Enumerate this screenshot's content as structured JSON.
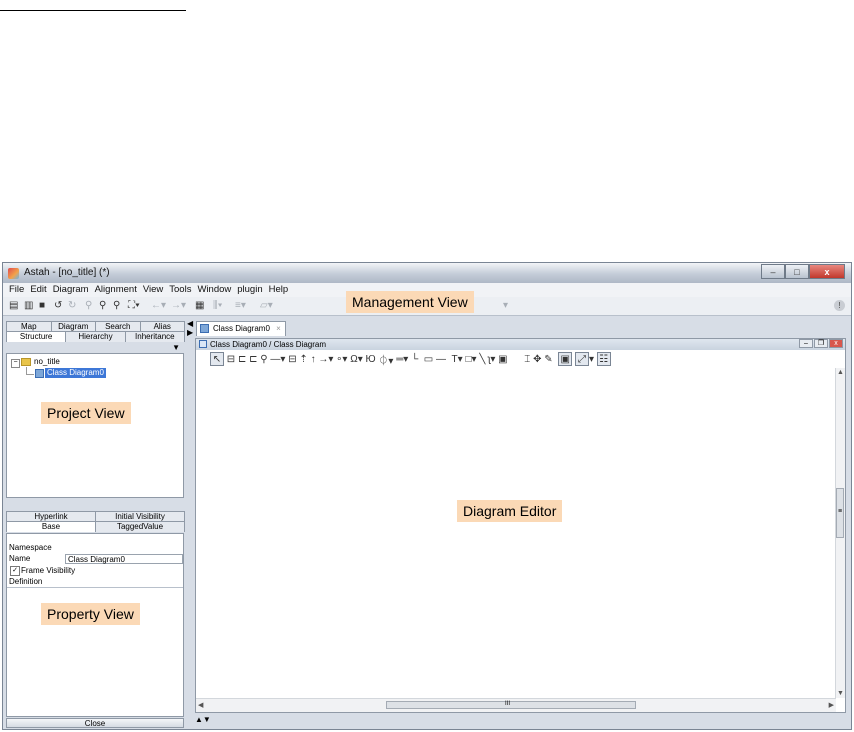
{
  "window": {
    "title": "Astah - [no_title] (*)"
  },
  "window_buttons": {
    "minimize": "–",
    "maximize": "□",
    "close": "x"
  },
  "menu": [
    "File",
    "Edit",
    "Diagram",
    "Alignment",
    "View",
    "Tools",
    "Window",
    "plugin",
    "Help"
  ],
  "toolbar": {
    "icons": [
      "new-file-icon",
      "open-file-icon",
      "save-icon",
      "undo-icon",
      "redo-icon",
      "zoom-out-icon",
      "zoom-in-icon",
      "zoom-icon",
      "fit-window-icon",
      "back-icon",
      "forward-icon",
      "grid-icon",
      "align-icon",
      "distribute-icon",
      "layout-icon"
    ],
    "help_icon": "!"
  },
  "callouts": {
    "management": "Management View",
    "project": "Project View",
    "property": "Property View",
    "editor": "Diagram Editor"
  },
  "project_tabs": {
    "row1": [
      "Map",
      "Diagram",
      "Search",
      "Alias"
    ],
    "row2": [
      "Structure",
      "Hierarchy",
      "Inheritance"
    ],
    "selected": "Structure"
  },
  "tree": {
    "root": "no_title",
    "child": "Class Diagram0"
  },
  "property_tabs": {
    "row1": [
      "Hyperlink",
      "Initial Visibility"
    ],
    "row2": [
      "Base",
      "TaggedValue"
    ],
    "selected": "Base"
  },
  "properties": {
    "namespace_label": "Namespace",
    "name_label": "Name",
    "name_value": "Class Diagram0",
    "frame_visibility_label": "Frame Visibility",
    "frame_visibility_checked": true,
    "definition_label": "Definition"
  },
  "close_button": "Close",
  "editor": {
    "tab_label": "Class Diagram0",
    "tab_close": "×",
    "header": "Class Diagram0 / Class Diagram",
    "hscroll_grip": "III",
    "vscroll_grip": "≡"
  },
  "colors": {
    "callout_bg": "#fbd9b6",
    "selection": "#3d77d7",
    "chrome": "#d7dde6"
  }
}
